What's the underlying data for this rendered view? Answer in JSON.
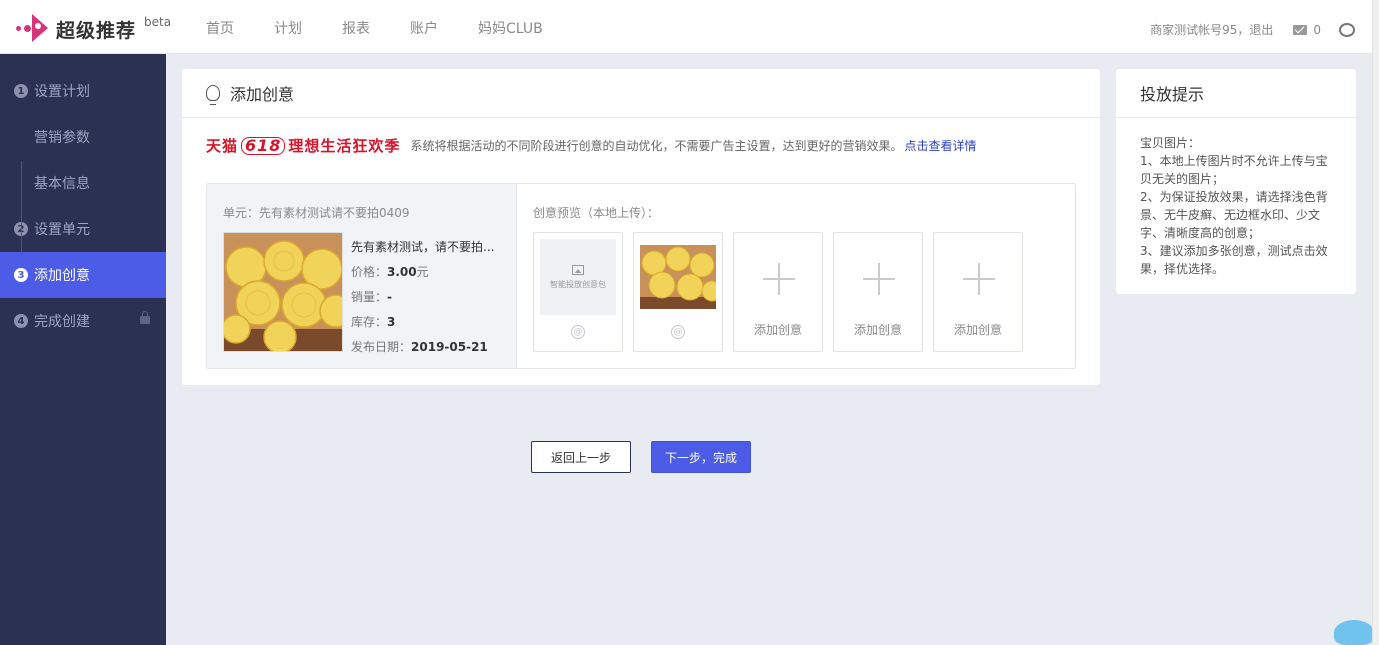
{
  "header": {
    "brand": "超级推荐",
    "beta": "beta",
    "nav": [
      "首页",
      "计划",
      "报表",
      "账户",
      "妈妈CLUB"
    ],
    "user": "商家测试帐号95，退出",
    "mail_count": "0"
  },
  "sidebar": {
    "items": [
      {
        "num": "1",
        "label": "设置计划"
      },
      {
        "label": "营销参数"
      },
      {
        "label": "基本信息"
      },
      {
        "num": "2",
        "label": "设置单元"
      },
      {
        "num": "3",
        "label": "添加创意"
      },
      {
        "num": "4",
        "label": "完成创建"
      }
    ]
  },
  "card": {
    "title": "添加创意",
    "promo_logo_a": "天猫",
    "promo_logo_618": "618",
    "promo_logo_b": "理想生活狂欢季",
    "promo_text": "系统将根据活动的不同阶段进行创意的自动优化，不需要广告主设置，达到更好的营销效果。",
    "promo_link": "点击查看详情",
    "unit_label": "单元：先有素材测试请不要拍0409",
    "product": {
      "name": "先有素材测试，请不要拍...",
      "price_label": "价格：",
      "price": "3.00",
      "price_unit": "元",
      "sales_label": "销量：",
      "sales": "-",
      "stock_label": "库存：",
      "stock": "3",
      "date_label": "发布日期：",
      "date": "2019-05-21"
    },
    "preview_label": "创意预览（本地上传）：",
    "slot_hint": "智能投放创意包",
    "add_label": "添加创意"
  },
  "tips": {
    "title": "投放提示",
    "lines": [
      "宝贝图片：",
      "1、本地上传图片时不允许上传与宝贝无关的图片；",
      "2、为保证投放效果，请选择浅色背景、无牛皮癣、无边框水印、少文字、清晰度高的创意；",
      "3、建议添加多张创意，测试点击效果，择优选择。"
    ]
  },
  "buttons": {
    "back": "返回上一步",
    "next": "下一步，完成"
  },
  "colors": {
    "accent": "#4d5ce6",
    "sidebar_bg": "#2b3152",
    "brand": "#d6357c",
    "promo_red": "#d9142a"
  }
}
